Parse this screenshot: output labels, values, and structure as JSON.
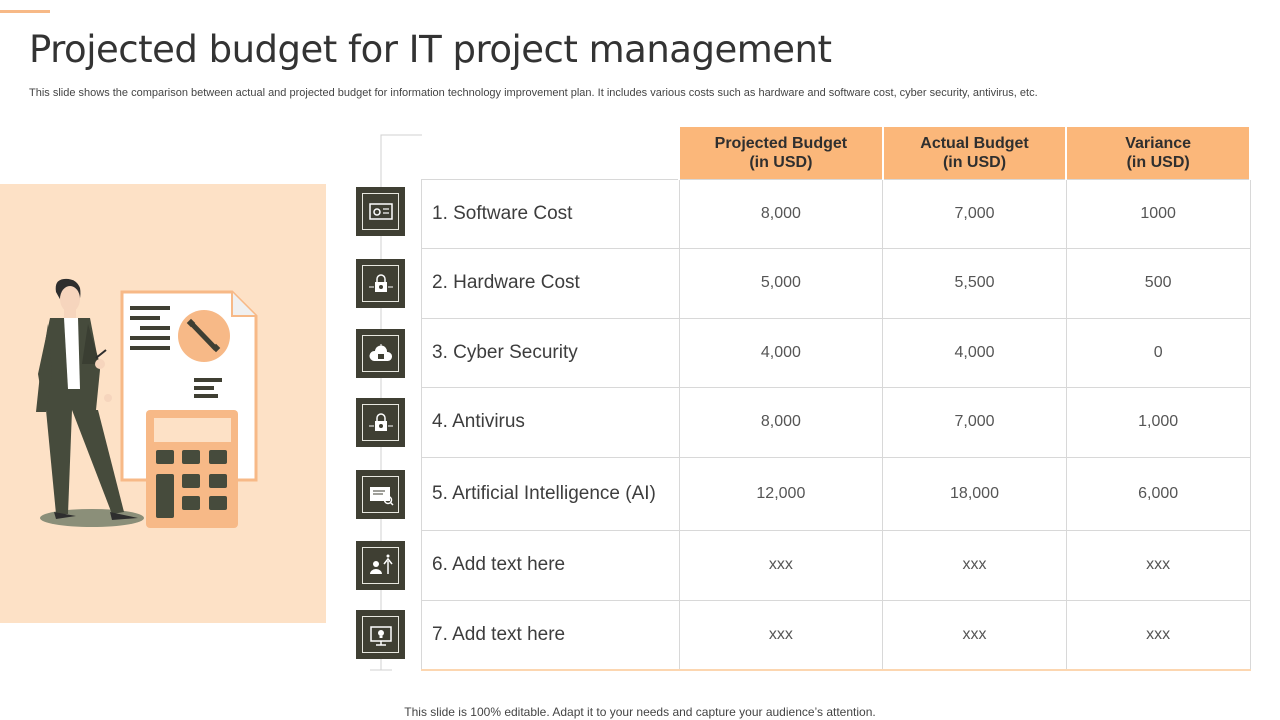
{
  "title": "Projected budget for IT project management",
  "subtitle": "This slide shows the comparison between actual and projected budget for information technology improvement plan. It includes various costs such as hardware and software cost, cyber security, antivirus, etc.",
  "table": {
    "headers": [
      {
        "line1": "Projected Budget",
        "line2": "(in USD)"
      },
      {
        "line1": "Actual Budget",
        "line2": "(in USD)"
      },
      {
        "line1": "Variance",
        "line2": "(in USD)"
      }
    ],
    "rows": [
      {
        "label": "1. Software Cost",
        "projected": "8,000",
        "actual": "7,000",
        "variance": "1000",
        "icon": "software-settings-icon"
      },
      {
        "label": "2. Hardware Cost",
        "projected": "5,000",
        "actual": "5,500",
        "variance": "500",
        "icon": "hardware-lock-icon"
      },
      {
        "label": "3. Cyber Security",
        "projected": "4,000",
        "actual": "4,000",
        "variance": "0",
        "icon": "cloud-security-icon"
      },
      {
        "label": "4. Antivirus",
        "projected": "8,000",
        "actual": "7,000",
        "variance": "1,000",
        "icon": "antivirus-lock-icon"
      },
      {
        "label": "5. Artificial Intelligence (AI)",
        "projected": "12,000",
        "actual": "18,000",
        "variance": "6,000",
        "icon": "ai-screen-icon"
      },
      {
        "label": "6. Add text here",
        "projected": "xxx",
        "actual": "xxx",
        "variance": "xxx",
        "icon": "person-growth-icon"
      },
      {
        "label": "7. Add text here",
        "projected": "xxx",
        "actual": "xxx",
        "variance": "xxx",
        "icon": "monitor-idea-icon"
      }
    ]
  },
  "footer": "This slide is 100% editable. Adapt it to your needs and capture your audience’s attention.",
  "colors": {
    "accent": "#fbb77a",
    "panel": "#fde1c6",
    "icon_bg": "#3f3f33",
    "person_dark": "#464b3c"
  }
}
